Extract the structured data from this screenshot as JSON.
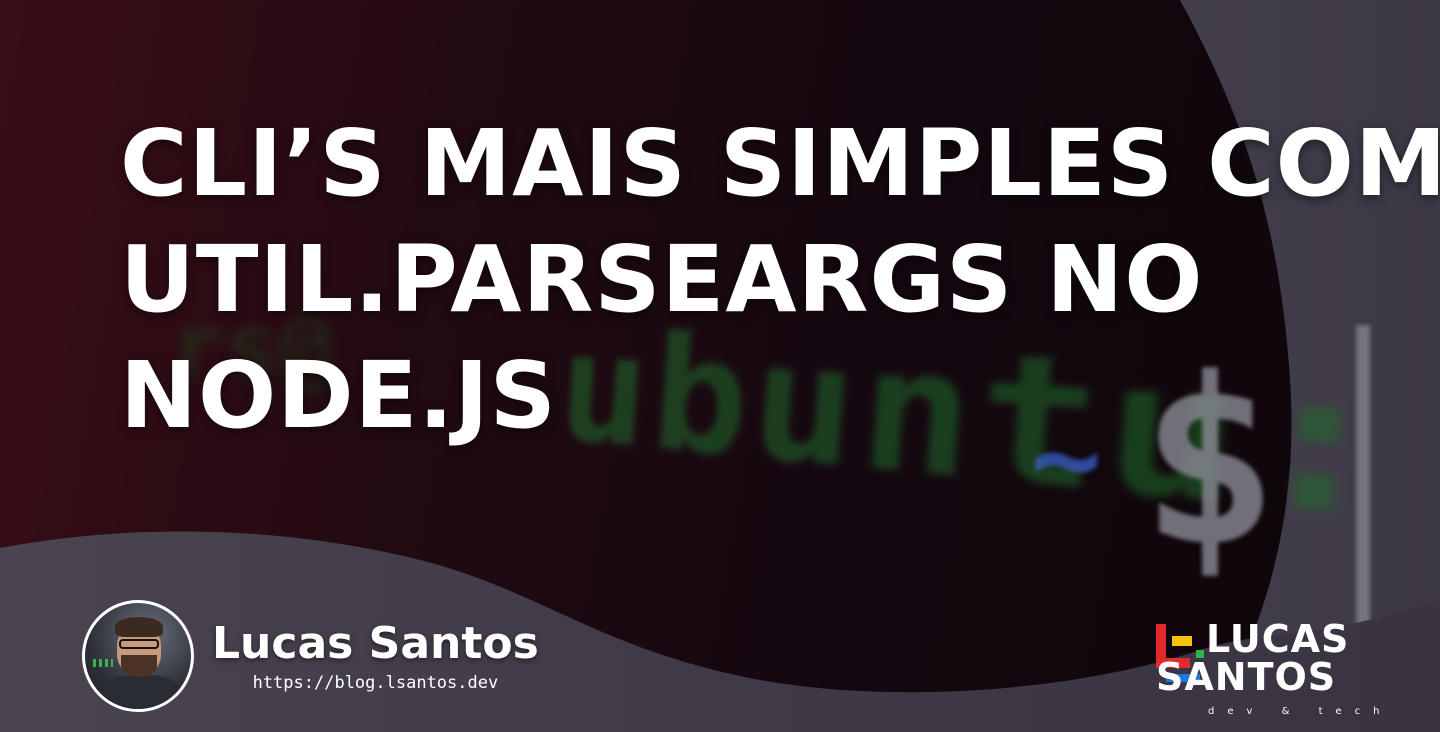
{
  "title": {
    "line1": "CLI’S MAIS SIMPLES COM",
    "line2": "UTIL.PARSEARGS NO",
    "line3": "NODE.JS"
  },
  "background": {
    "terminal_prefix": "rs@",
    "terminal_host": "ubuntu:",
    "terminal_tilde": "~",
    "terminal_prompt": "$"
  },
  "author": {
    "name": "Lucas Santos",
    "url": "https://blog.lsantos.dev"
  },
  "brand": {
    "word1": "LUCAS",
    "word2": "SANTOS",
    "tagline": "dev & tech"
  },
  "colors": {
    "brand_red": "#e32a2a",
    "brand_yellow": "#f4c20d",
    "brand_green": "#2eb34a",
    "brand_blue": "#1e78e0",
    "terminal_green": "#2a8a36",
    "terminal_blue": "#3a5ec8"
  }
}
